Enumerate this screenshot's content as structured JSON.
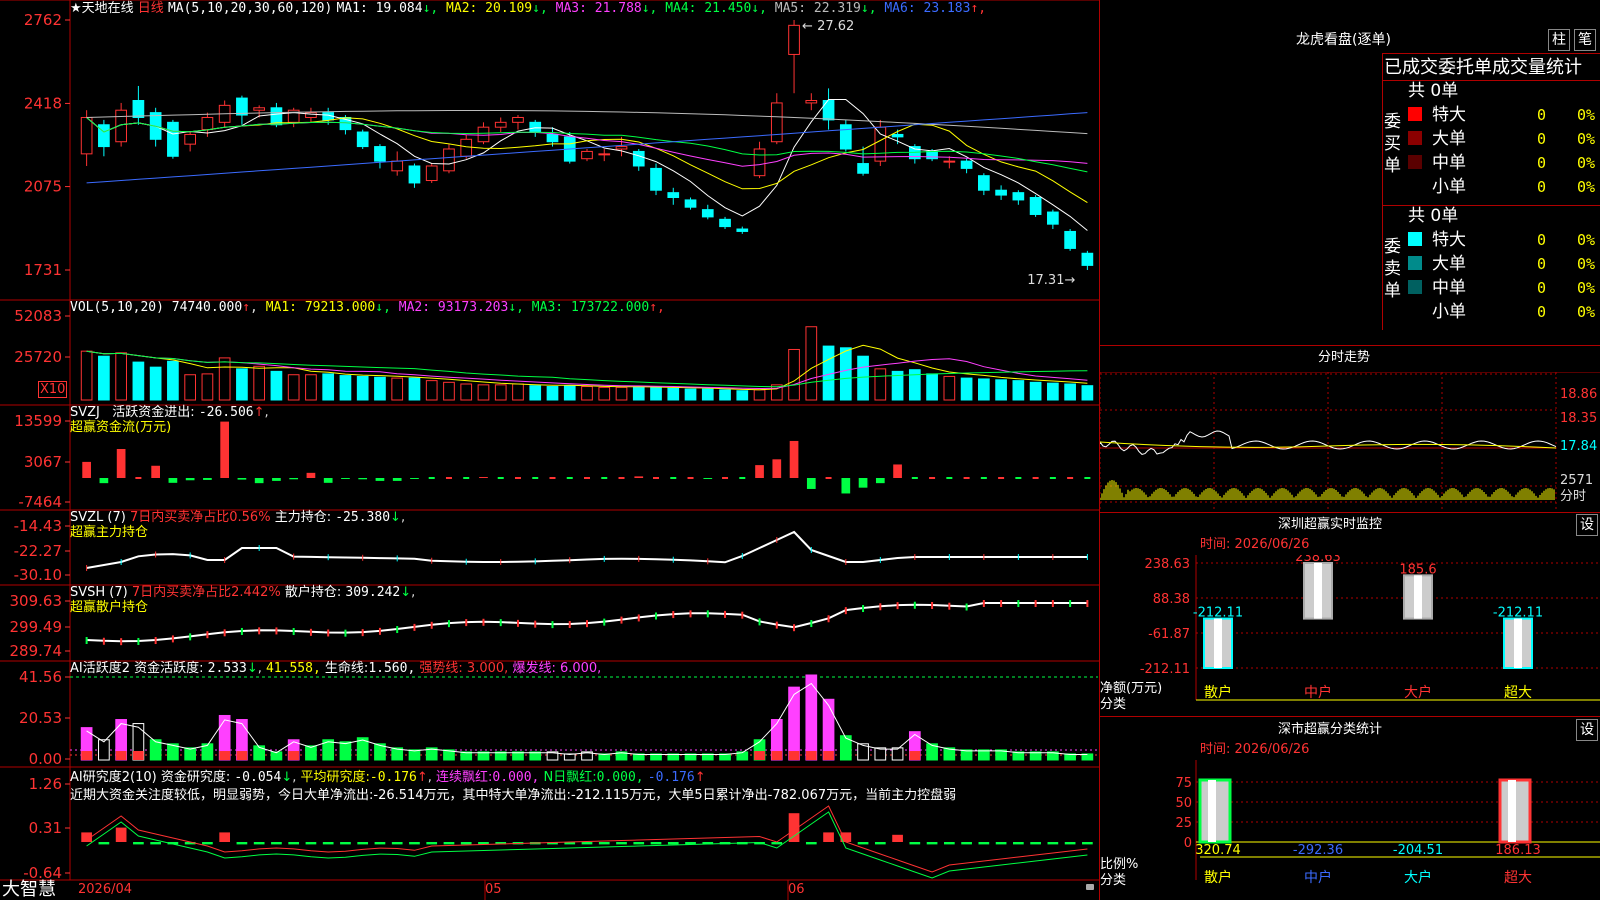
{
  "stock": {
    "name": "★天地在线",
    "period": "日线"
  },
  "colors": {
    "up": "#ff3333",
    "down": "#00ffff",
    "grid": "#b00000",
    "bg": "#000000"
  },
  "kline": {
    "ma_label": "MA(5,10,20,30,60,120)",
    "ma": [
      {
        "label": "MA1: 19.084",
        "arrow": "↓",
        "color": "#ffffff"
      },
      {
        "label": "MA2: 20.109",
        "arrow": "↓",
        "color": "#ffff00"
      },
      {
        "label": "MA3: 21.788",
        "arrow": "↓",
        "color": "#ff40ff"
      },
      {
        "label": "MA4: 21.450",
        "arrow": "↓",
        "color": "#00ff44"
      },
      {
        "label": "MA5: 22.319",
        "arrow": "↓",
        "color": "#bbbbbb"
      },
      {
        "label": "MA6: 23.183",
        "arrow": "↑",
        "color": "#3b6bff"
      }
    ],
    "yticks": [
      "27.62",
      "24.18",
      "20.75",
      "17.31"
    ],
    "high_label": "27.62",
    "low_label": "17.31",
    "ylim": [
      17.31,
      27.62
    ],
    "candles": [
      [
        22.1,
        23.6,
        21.6,
        23.9
      ],
      [
        23.3,
        22.4,
        22.0,
        23.5
      ],
      [
        22.6,
        23.9,
        22.4,
        24.2
      ],
      [
        24.3,
        23.6,
        23.3,
        24.9
      ],
      [
        23.8,
        22.7,
        22.4,
        24.0
      ],
      [
        23.4,
        22.0,
        21.9,
        23.5
      ],
      [
        22.5,
        22.9,
        22.2,
        23.0
      ],
      [
        23.1,
        23.6,
        22.8,
        23.8
      ],
      [
        23.4,
        24.1,
        23.2,
        24.3
      ],
      [
        24.4,
        23.7,
        23.3,
        24.5
      ],
      [
        23.9,
        24.0,
        23.6,
        24.1
      ],
      [
        24.0,
        23.3,
        23.2,
        24.2
      ],
      [
        23.4,
        23.9,
        23.2,
        24.0
      ],
      [
        23.6,
        23.8,
        23.4,
        24.0
      ],
      [
        23.8,
        23.5,
        23.3,
        24.0
      ],
      [
        23.6,
        23.1,
        22.9,
        23.7
      ],
      [
        23.0,
        22.4,
        22.3,
        23.1
      ],
      [
        22.4,
        21.8,
        21.5,
        22.5
      ],
      [
        21.4,
        21.8,
        21.2,
        22.2
      ],
      [
        21.6,
        20.9,
        20.7,
        21.7
      ],
      [
        21.0,
        21.6,
        20.9,
        21.7
      ],
      [
        21.4,
        22.3,
        21.3,
        22.5
      ],
      [
        22.0,
        22.7,
        21.9,
        22.9
      ],
      [
        22.6,
        23.2,
        22.5,
        23.4
      ],
      [
        23.2,
        23.4,
        23.0,
        23.6
      ],
      [
        23.4,
        23.6,
        23.1,
        23.7
      ],
      [
        23.4,
        23.0,
        22.8,
        23.5
      ],
      [
        22.9,
        22.6,
        22.4,
        23.2
      ],
      [
        22.8,
        21.8,
        21.7,
        23.0
      ],
      [
        21.9,
        22.2,
        21.8,
        22.3
      ],
      [
        22.1,
        22.1,
        21.8,
        22.3
      ],
      [
        22.3,
        22.4,
        22.0,
        22.8
      ],
      [
        22.2,
        21.6,
        21.4,
        22.3
      ],
      [
        21.5,
        20.6,
        20.4,
        21.7
      ],
      [
        20.5,
        20.3,
        20.0,
        20.7
      ],
      [
        20.2,
        19.9,
        19.8,
        20.3
      ],
      [
        19.8,
        19.5,
        19.4,
        20.0
      ],
      [
        19.4,
        19.1,
        19.0,
        19.5
      ],
      [
        19.0,
        18.9,
        18.8,
        19.1
      ],
      [
        21.2,
        22.3,
        21.1,
        22.6
      ],
      [
        22.6,
        24.2,
        22.5,
        24.6
      ],
      [
        26.2,
        27.4,
        24.6,
        27.62
      ],
      [
        24.2,
        24.3,
        23.9,
        24.6
      ],
      [
        24.3,
        23.5,
        23.1,
        24.8
      ],
      [
        23.3,
        22.3,
        22.2,
        23.5
      ],
      [
        21.7,
        21.3,
        21.2,
        22.4
      ],
      [
        21.8,
        23.2,
        21.6,
        23.5
      ],
      [
        22.9,
        22.8,
        22.5,
        23.1
      ],
      [
        22.4,
        21.9,
        21.7,
        22.5
      ],
      [
        22.2,
        21.9,
        21.8,
        22.3
      ],
      [
        21.8,
        21.8,
        21.5,
        22.0
      ],
      [
        21.8,
        21.5,
        21.3,
        21.9
      ],
      [
        21.2,
        20.6,
        20.4,
        21.3
      ],
      [
        20.6,
        20.4,
        20.2,
        20.8
      ],
      [
        20.5,
        20.2,
        20.0,
        20.6
      ],
      [
        20.3,
        19.6,
        19.5,
        20.4
      ],
      [
        19.7,
        19.2,
        19.0,
        19.8
      ],
      [
        18.9,
        18.2,
        18.1,
        19.0
      ],
      [
        18.0,
        17.5,
        17.31,
        18.1
      ]
    ]
  },
  "vol": {
    "label": "VOL(5,10,20)",
    "value": "74740.000",
    "arrow": "↑",
    "ma": [
      {
        "label": "MA1: 79213.000",
        "arrow": "↓",
        "color": "#ffff00"
      },
      {
        "label": "MA2: 93173.203",
        "arrow": "↓",
        "color": "#ff40ff"
      },
      {
        "label": "MA3: 173722.000",
        "arrow": "↑",
        "color": "#00ff44"
      }
    ],
    "yticks": [
      "52083",
      "25720"
    ],
    "unit": "X10",
    "values": [
      5.8,
      5.2,
      5.6,
      4.5,
      3.9,
      4.6,
      3.0,
      3.1,
      5.0,
      3.7,
      4.0,
      3.4,
      3.0,
      3.0,
      3.1,
      2.9,
      2.8,
      2.7,
      2.6,
      2.6,
      2.3,
      2.1,
      1.9,
      1.8,
      1.8,
      1.9,
      1.7,
      1.6,
      1.7,
      1.6,
      1.5,
      1.5,
      1.6,
      1.5,
      1.4,
      1.3,
      1.3,
      1.2,
      1.1,
      1.2,
      1.8,
      6.0,
      8.7,
      6.4,
      6.2,
      5.2,
      3.7,
      3.4,
      3.6,
      3.1,
      2.8,
      2.6,
      2.5,
      2.4,
      2.3,
      2.1,
      2.0,
      1.9,
      1.7,
      1.5,
      1.4,
      1.4
    ]
  },
  "svzj": {
    "label": "SVZJ",
    "desc": "活跃资金进出:",
    "value": "-26.506",
    "arrow": "↑",
    "sub": "超赢资金流(万元)",
    "yticks": [
      "13599",
      "3067",
      "-7464"
    ],
    "values": [
      5.0,
      -1.6,
      9.0,
      0.0,
      3.8,
      -1.5,
      -0.7,
      -0.6,
      17.5,
      -0.5,
      -1.6,
      -0.9,
      -0.4,
      1.6,
      -1.5,
      -0.3,
      -0.4,
      -0.9,
      -0.9,
      -0.3,
      0.0,
      0.0,
      0.0,
      0.3,
      0.0,
      0.0,
      0.0,
      0.0,
      0.0,
      0.0,
      0.0,
      0.0,
      0.5,
      0.0,
      0.0,
      0.0,
      -0.3,
      0.0,
      0.0,
      0.0,
      0.0,
      0.0,
      0.0,
      0.0,
      0.0,
      0.0,
      0.0,
      0.0,
      0.0,
      0.0,
      0.0,
      0.0,
      0.0,
      0.0,
      0.0,
      0.0,
      0.0,
      0.0,
      0.0,
      0.0,
      0.0,
      0.0
    ],
    "special": {
      "39": 4.0,
      "40": 5.8,
      "41": 11.5,
      "42": -3.4,
      "44": -4.8,
      "45": -3.0,
      "46": -1.6,
      "47": 4.2
    }
  },
  "svzl": {
    "label": "SVZL (7)",
    "desc": "7日内买卖净占比0.56%",
    "desc2": "主力持仓:",
    "value": "-25.380",
    "arrow": "↓",
    "sub": "超赢主力持仓",
    "yticks": [
      "-14.43",
      "-22.27",
      "-30.10"
    ]
  },
  "svsh": {
    "label": "SVSH (7)",
    "desc": "7日内买卖净占比2.442%",
    "desc2": "散户持仓:",
    "value": "309.242",
    "arrow": "↓",
    "sub": "超赢散户持仓",
    "yticks": [
      "309.63",
      "299.49",
      "289.74"
    ]
  },
  "ai": {
    "label": "AI活跃度2",
    "desc": "资金活跃度:",
    "value": "2.533",
    "arrow": "↓",
    "v2": "41.558,",
    "life": "生命线:",
    "life_value": "1.560,",
    "strong": "强势线: 3.000,",
    "burst": "爆发线: 6.000,",
    "yticks": [
      "41.56",
      "20.53",
      "0.00"
    ]
  },
  "research": {
    "label": "AI研究度2(10)",
    "desc": "资金研究度:",
    "value": "-0.054",
    "arrow": "↓",
    "avg": "平均研究度:",
    "avg_value": "-0.176",
    "avg_arrow": "↑",
    "red": "连续飘红:",
    "red_value": "0.000,",
    "nred": "N日飘红:",
    "nred_value": "0.000,",
    "last": "-0.176",
    "last_arrow": "↑",
    "note": "近期大资金关注度较低，明显弱势，今日大单净流出:-26.514万元，其中特大单净流出:-212.115万元，大单5日累计净出-782.067万元，当前主力控盘弱",
    "yticks": [
      "1.26",
      "0.31",
      "-0.64"
    ]
  },
  "xaxis": {
    "brand": "大智慧",
    "labels": [
      "2026/04",
      "05",
      "06"
    ]
  },
  "right": {
    "lhb": {
      "title": "龙虎看盘(逐单)",
      "btn1": "柱",
      "btn2": "笔",
      "subtitle": "已成交委托单成交量统计",
      "buy": {
        "side": "委买单",
        "total": "共 0单",
        "rows": [
          {
            "label": "特大",
            "count": "0",
            "pct": "0%",
            "color": "#ff0000"
          },
          {
            "label": "大单",
            "count": "0",
            "pct": "0%",
            "color": "#8b0000"
          },
          {
            "label": "中单",
            "count": "0",
            "pct": "0%",
            "color": "#5a0000"
          },
          {
            "label": "小单",
            "count": "0",
            "pct": "0%",
            "color": "#000000"
          }
        ]
      },
      "sell": {
        "side": "委卖单",
        "total": "共 0单",
        "rows": [
          {
            "label": "特大",
            "count": "0",
            "pct": "0%",
            "color": "#00ffff"
          },
          {
            "label": "大单",
            "count": "0",
            "pct": "0%",
            "color": "#008b8b"
          },
          {
            "label": "中单",
            "count": "0",
            "pct": "0%",
            "color": "#006060"
          },
          {
            "label": "小单",
            "count": "0",
            "pct": "0%",
            "color": "#000000"
          }
        ]
      }
    },
    "fenshi": {
      "title": "分时走势",
      "yticks": [
        "18.86",
        "18.35",
        "17.84"
      ],
      "vol_tick": "2571",
      "vol_unit": "分时"
    },
    "monitor": {
      "title": "深圳超赢实时监控",
      "btn": "设",
      "time": "时间: 2026/06/26",
      "yticks": [
        "238.63",
        "88.38",
        "-61.87",
        "-212.11"
      ],
      "ylabel": "净额(万元)",
      "xlabel": "分类",
      "cats": [
        "散户",
        "中户",
        "大户",
        "超大"
      ],
      "values": [
        -212.11,
        238.63,
        185.6,
        -212.11
      ],
      "labels": [
        "-212.11",
        "238.63",
        "185.6",
        "-212.11"
      ]
    },
    "classify": {
      "title": "深市超赢分类统计",
      "btn": "设",
      "time": "时间: 2026/06/26",
      "yticks": [
        "75",
        "50",
        "25",
        "0"
      ],
      "ylabel": "比例%",
      "xlabel": "分类",
      "cats": [
        "散户",
        "中户",
        "大户",
        "超大"
      ],
      "values": [
        "320.74",
        "-292.36",
        "-204.51",
        "186.13"
      ],
      "cat_colors": [
        "#ffff00",
        "#3b6bff",
        "#00ffff",
        "#ff3333"
      ]
    }
  }
}
